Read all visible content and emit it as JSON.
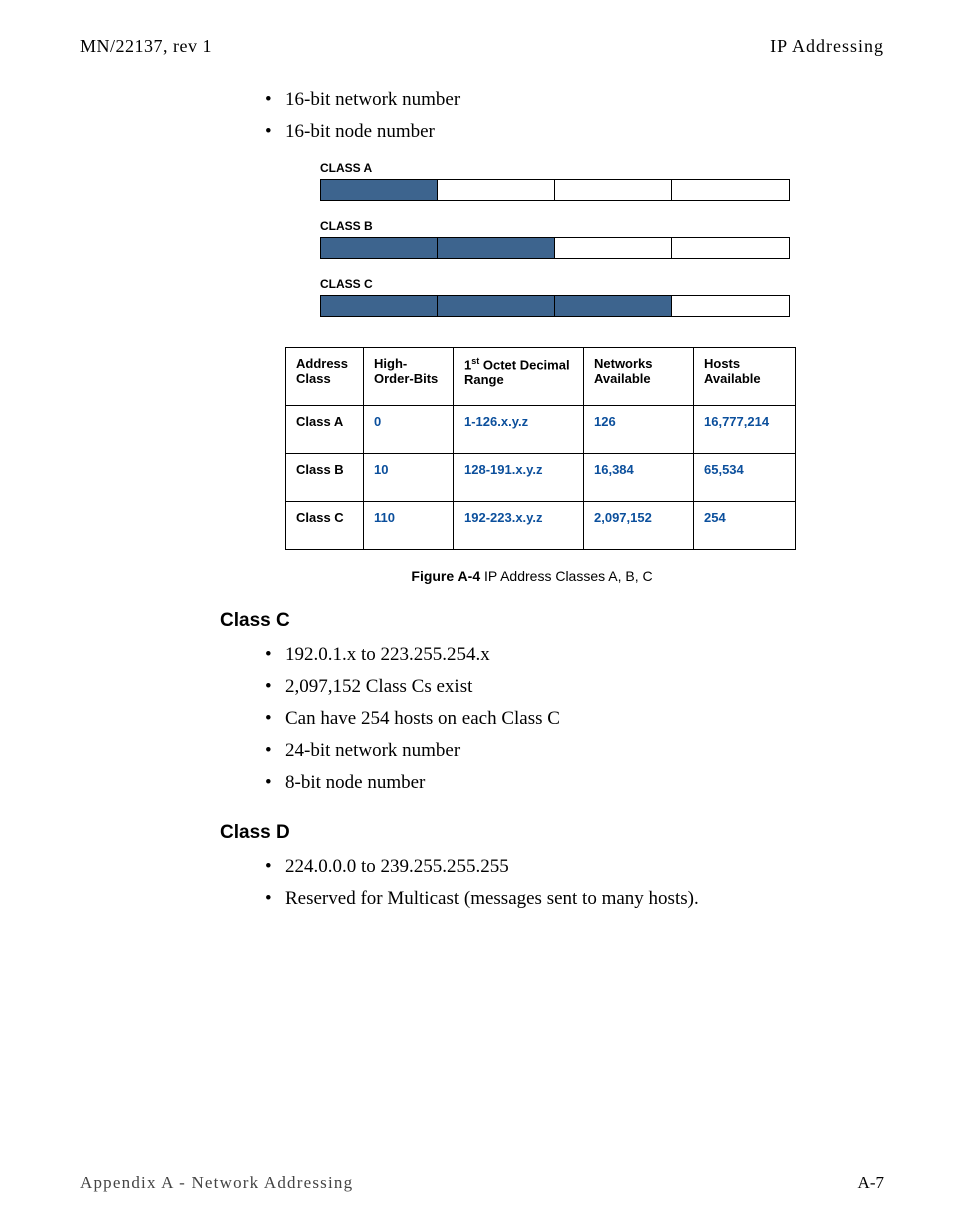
{
  "header": {
    "left": "MN/22137, rev 1",
    "right": "IP Addressing"
  },
  "topBullets": [
    "16-bit network number",
    "16-bit node number"
  ],
  "diagram": {
    "rows": [
      {
        "label": "CLASS A",
        "filled": 1
      },
      {
        "label": "CLASS B",
        "filled": 2
      },
      {
        "label": "CLASS C",
        "filled": 3
      }
    ]
  },
  "table": {
    "headers": [
      "Address Class",
      "High-Order-Bits",
      "1st Octet Decimal Range",
      "Networks Available",
      "Hosts Available"
    ],
    "sup": "st",
    "rows": [
      {
        "cls": "Class A",
        "bits": "0",
        "range": "1-126.x.y.z",
        "nets": "126",
        "hosts": "16,777,214"
      },
      {
        "cls": "Class B",
        "bits": "10",
        "range": "128-191.x.y.z",
        "nets": "16,384",
        "hosts": "65,534"
      },
      {
        "cls": "Class C",
        "bits": "110",
        "range": "192-223.x.y.z",
        "nets": "2,097,152",
        "hosts": "254"
      }
    ]
  },
  "caption": {
    "bold": "Figure A-4",
    "rest": "   IP Address Classes A, B, C"
  },
  "sectionC": {
    "title": "Class C",
    "items": [
      "192.0.1.x to 223.255.254.x",
      "2,097,152 Class Cs exist",
      "Can have 254 hosts on each Class C",
      "24-bit network number",
      "8-bit node number"
    ]
  },
  "sectionD": {
    "title": "Class D",
    "items": [
      "224.0.0.0 to 239.255.255.255",
      "Reserved for Multicast (messages sent to many hosts)."
    ]
  },
  "footer": {
    "left": "Appendix A - Network Addressing",
    "right": "A-7"
  }
}
